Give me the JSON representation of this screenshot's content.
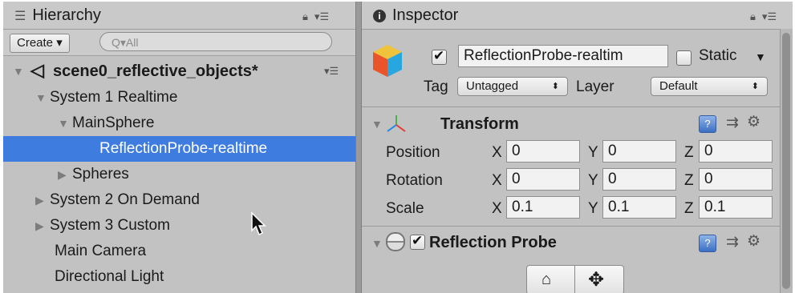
{
  "hierarchy": {
    "tab_title": "Hierarchy",
    "create_label": "Create ▾",
    "search_placeholder": "Q▾All",
    "scene_name": "scene0_reflective_objects*",
    "items": [
      {
        "label": "System 1 Realtime"
      },
      {
        "label": "MainSphere"
      },
      {
        "label": "ReflectionProbe-realtime"
      },
      {
        "label": "Spheres"
      },
      {
        "label": "System 2 On Demand"
      },
      {
        "label": "System 3 Custom"
      },
      {
        "label": "Main Camera"
      },
      {
        "label": "Directional Light"
      }
    ]
  },
  "inspector": {
    "tab_title": "Inspector",
    "object_name": "ReflectionProbe-realtim",
    "static_label": "Static",
    "tag_label": "Tag",
    "tag_value": "Untagged",
    "layer_label": "Layer",
    "layer_value": "Default",
    "transform": {
      "title": "Transform",
      "rows": [
        {
          "label": "Position",
          "x": "0",
          "y": "0",
          "z": "0"
        },
        {
          "label": "Rotation",
          "x": "0",
          "y": "0",
          "z": "0"
        },
        {
          "label": "Scale",
          "x": "0.1",
          "y": "0.1",
          "z": "0.1"
        }
      ]
    },
    "reflection_probe": {
      "title": "Reflection Probe"
    }
  },
  "axis_letters": {
    "x": "X",
    "y": "Y",
    "z": "Z"
  }
}
